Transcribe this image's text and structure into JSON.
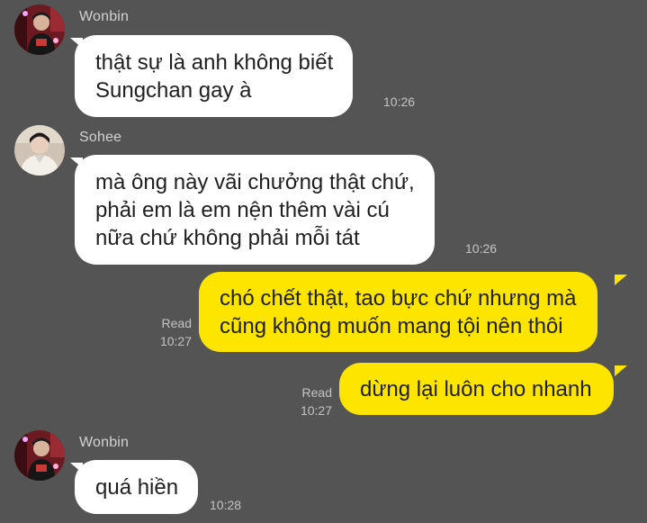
{
  "colors": {
    "background": "#545454",
    "incoming_bubble": "#ffffff",
    "outgoing_bubble": "#fee500",
    "meta_text": "#c4c4c4"
  },
  "messages": [
    {
      "direction": "incoming",
      "sender": "Wonbin",
      "avatar_icon": "avatar-photo-red",
      "text": "thật sự là anh không biết\nSungchan gay à",
      "time": "10:26"
    },
    {
      "direction": "incoming",
      "sender": "Sohee",
      "avatar_icon": "avatar-photo-light",
      "text": "mà ông này vãi chưởng thật chứ,\nphải em là em nện thêm vài cú\nnữa chứ không phải mỗi tát",
      "time": "10:26"
    },
    {
      "direction": "outgoing",
      "read_label": "Read",
      "text": "chó chết thật, tao bực chứ nhưng mà\ncũng không muốn mang tội nên thôi",
      "time": "10:27"
    },
    {
      "direction": "outgoing",
      "read_label": "Read",
      "text": "dừng lại luôn cho nhanh",
      "time": "10:27"
    },
    {
      "direction": "incoming",
      "sender": "Wonbin",
      "avatar_icon": "avatar-photo-red",
      "text": "quá hiền",
      "time": "10:28"
    }
  ]
}
